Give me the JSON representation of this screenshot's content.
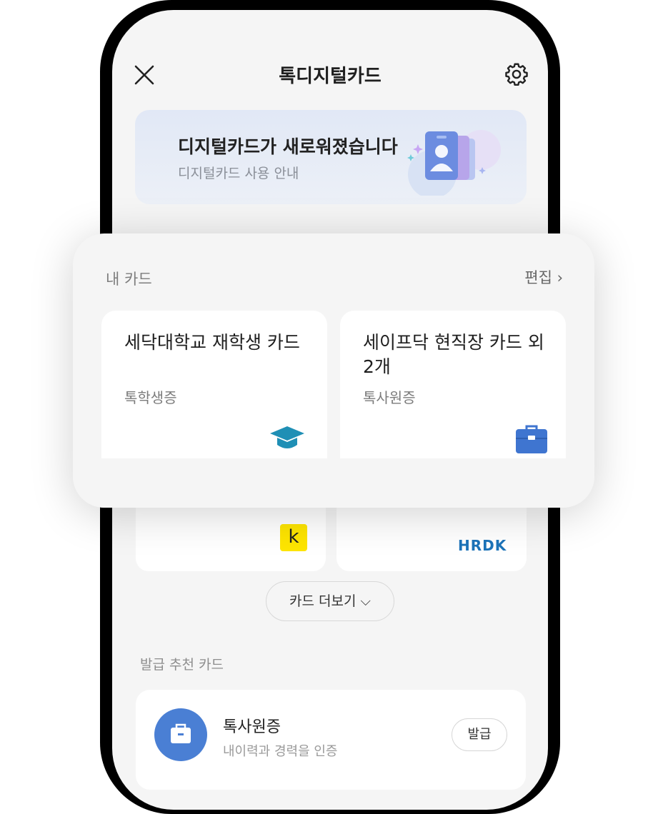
{
  "header": {
    "title": "톡디지털카드"
  },
  "banner": {
    "title": "디지털카드가 새로워졌습니다",
    "subtitle": "디지털카드 사용 안내"
  },
  "my_cards": {
    "label": "내 카드",
    "edit_label": "편집 ›",
    "cards": [
      {
        "title": "세닥대학교 재학생 카드",
        "type": "톡학생증",
        "icon": "graduation-cap-icon"
      },
      {
        "title": "세이프닥 현직장 카드 외 2개",
        "type": "톡사원증",
        "icon": "briefcase-icon"
      }
    ]
  },
  "peek_logos": {
    "kakao": "k",
    "hrdk": "HRDK"
  },
  "more_button": {
    "label": "카드 더보기 ⌵"
  },
  "recommended": {
    "label": "발급 추천 카드",
    "item": {
      "title": "톡사원증",
      "subtitle": "내이력과 경력을 인증",
      "button": "발급",
      "icon": "briefcase-icon"
    }
  },
  "colors": {
    "accent_blue": "#4a7fd4",
    "cap_teal": "#1f8fb5",
    "kakao_yellow": "#fee500",
    "hrdk_blue": "#1c73b9"
  }
}
